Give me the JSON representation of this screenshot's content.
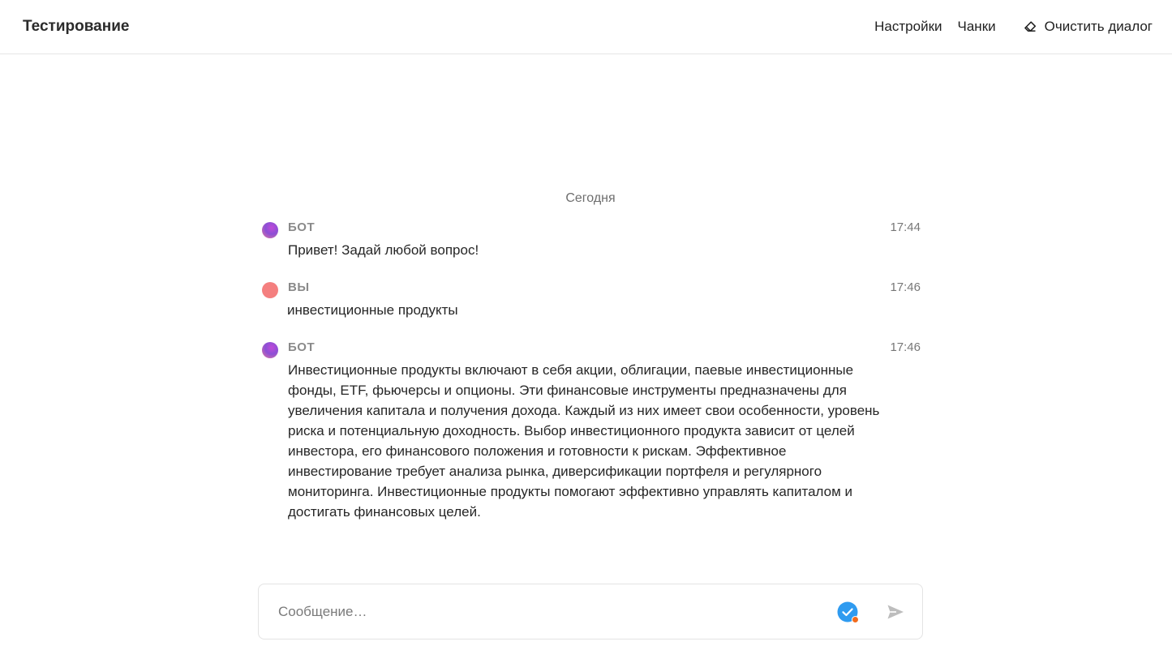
{
  "header": {
    "title": "Тестирование",
    "nav": [
      "Настройки",
      "Чанки"
    ],
    "clear_label": "Очистить диалог"
  },
  "chat": {
    "date_divider": "Сегодня",
    "messages": [
      {
        "author": "БОТ",
        "role": "bot",
        "time": "17:44",
        "text": "Привет! Задай любой вопрос!"
      },
      {
        "author": "ВЫ",
        "role": "user",
        "time": "17:46",
        "text": "инвестиционные продукты"
      },
      {
        "author": "БОТ",
        "role": "bot",
        "time": "17:46",
        "text": "Инвестиционные продукты включают в себя акции, облигации, паевые инвестиционные фонды, ETF, фьючерсы и опционы. Эти финансовые инструменты предназначены для увеличения капитала и получения дохода. Каждый из них имеет свои особенности, уровень риска и потенциальную доходность. Выбор инвестиционного продукта зависит от целей инвестора, его финансового положения и готовности к рискам. Эффективное инвестирование требует анализа рынка, диверсификации портфеля и регулярного мониторинга. Инвестиционные продукты помогают эффективно управлять капиталом и достигать финансовых целей."
      }
    ]
  },
  "composer": {
    "placeholder": "Сообщение…",
    "value": ""
  },
  "icons": {
    "clear": "eraser-icon",
    "check": "check-badge-icon",
    "send": "send-icon"
  },
  "colors": {
    "accent_blue": "#2f9bf0",
    "badge_orange": "#f26b1d",
    "user_avatar": "#f47f7f",
    "bot_avatar": "#9b4fd6"
  }
}
